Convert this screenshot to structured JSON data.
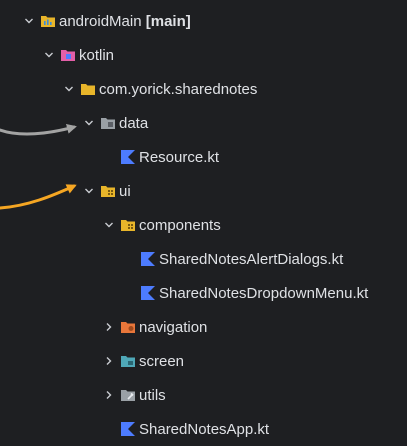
{
  "tree": [
    {
      "id": "androidMain",
      "label": "androidMain",
      "extra": " [main]",
      "depth": 0,
      "chevron": "down",
      "icon": "module-folder-icon"
    },
    {
      "id": "kotlin",
      "label": "kotlin",
      "depth": 1,
      "chevron": "down",
      "icon": "source-folder-icon"
    },
    {
      "id": "package-root",
      "label": "com.yorick.sharednotes",
      "depth": 2,
      "chevron": "down",
      "icon": "package-folder-icon"
    },
    {
      "id": "data",
      "label": "data",
      "depth": 3,
      "chevron": "down",
      "icon": "data-folder-icon"
    },
    {
      "id": "resource-kt",
      "label": "Resource.kt",
      "depth": 4,
      "chevron": "none",
      "icon": "kotlin-file-icon"
    },
    {
      "id": "ui",
      "label": "ui",
      "depth": 3,
      "chevron": "down",
      "icon": "ui-folder-icon"
    },
    {
      "id": "components",
      "label": "components",
      "depth": 4,
      "chevron": "down",
      "icon": "ui-folder-icon"
    },
    {
      "id": "alert-dialogs-kt",
      "label": "SharedNotesAlertDialogs.kt",
      "depth": 5,
      "chevron": "none",
      "icon": "kotlin-file-icon"
    },
    {
      "id": "dropdown-menu-kt",
      "label": "SharedNotesDropdownMenu.kt",
      "depth": 5,
      "chevron": "none",
      "icon": "kotlin-file-icon"
    },
    {
      "id": "navigation",
      "label": "navigation",
      "depth": 4,
      "chevron": "right",
      "icon": "navigation-folder-icon"
    },
    {
      "id": "screen",
      "label": "screen",
      "depth": 4,
      "chevron": "right",
      "icon": "screen-folder-icon"
    },
    {
      "id": "utils",
      "label": "utils",
      "depth": 4,
      "chevron": "right",
      "icon": "utils-folder-icon"
    },
    {
      "id": "app-kt",
      "label": "SharedNotesApp.kt",
      "depth": 4,
      "chevron": "none",
      "icon": "kotlin-file-icon"
    }
  ],
  "colors": {
    "background": "#1e1f22",
    "text": "#dfe1e5",
    "chevron": "#c9ccd1",
    "folder_yellow": "#e8b52a",
    "folder_pink": "#e35fa8",
    "folder_gray": "#9aa0a6",
    "folder_orange": "#e8763a",
    "folder_teal": "#4fa8b8",
    "kotlin_blue": "#4d7cff",
    "arrow_gray": "#a3a3a3",
    "arrow_orange": "#f5a623"
  },
  "annotations": [
    {
      "target": "data",
      "color": "gray",
      "icon": "annotation-arrow-icon"
    },
    {
      "target": "ui",
      "color": "orange",
      "icon": "annotation-arrow-icon"
    }
  ]
}
